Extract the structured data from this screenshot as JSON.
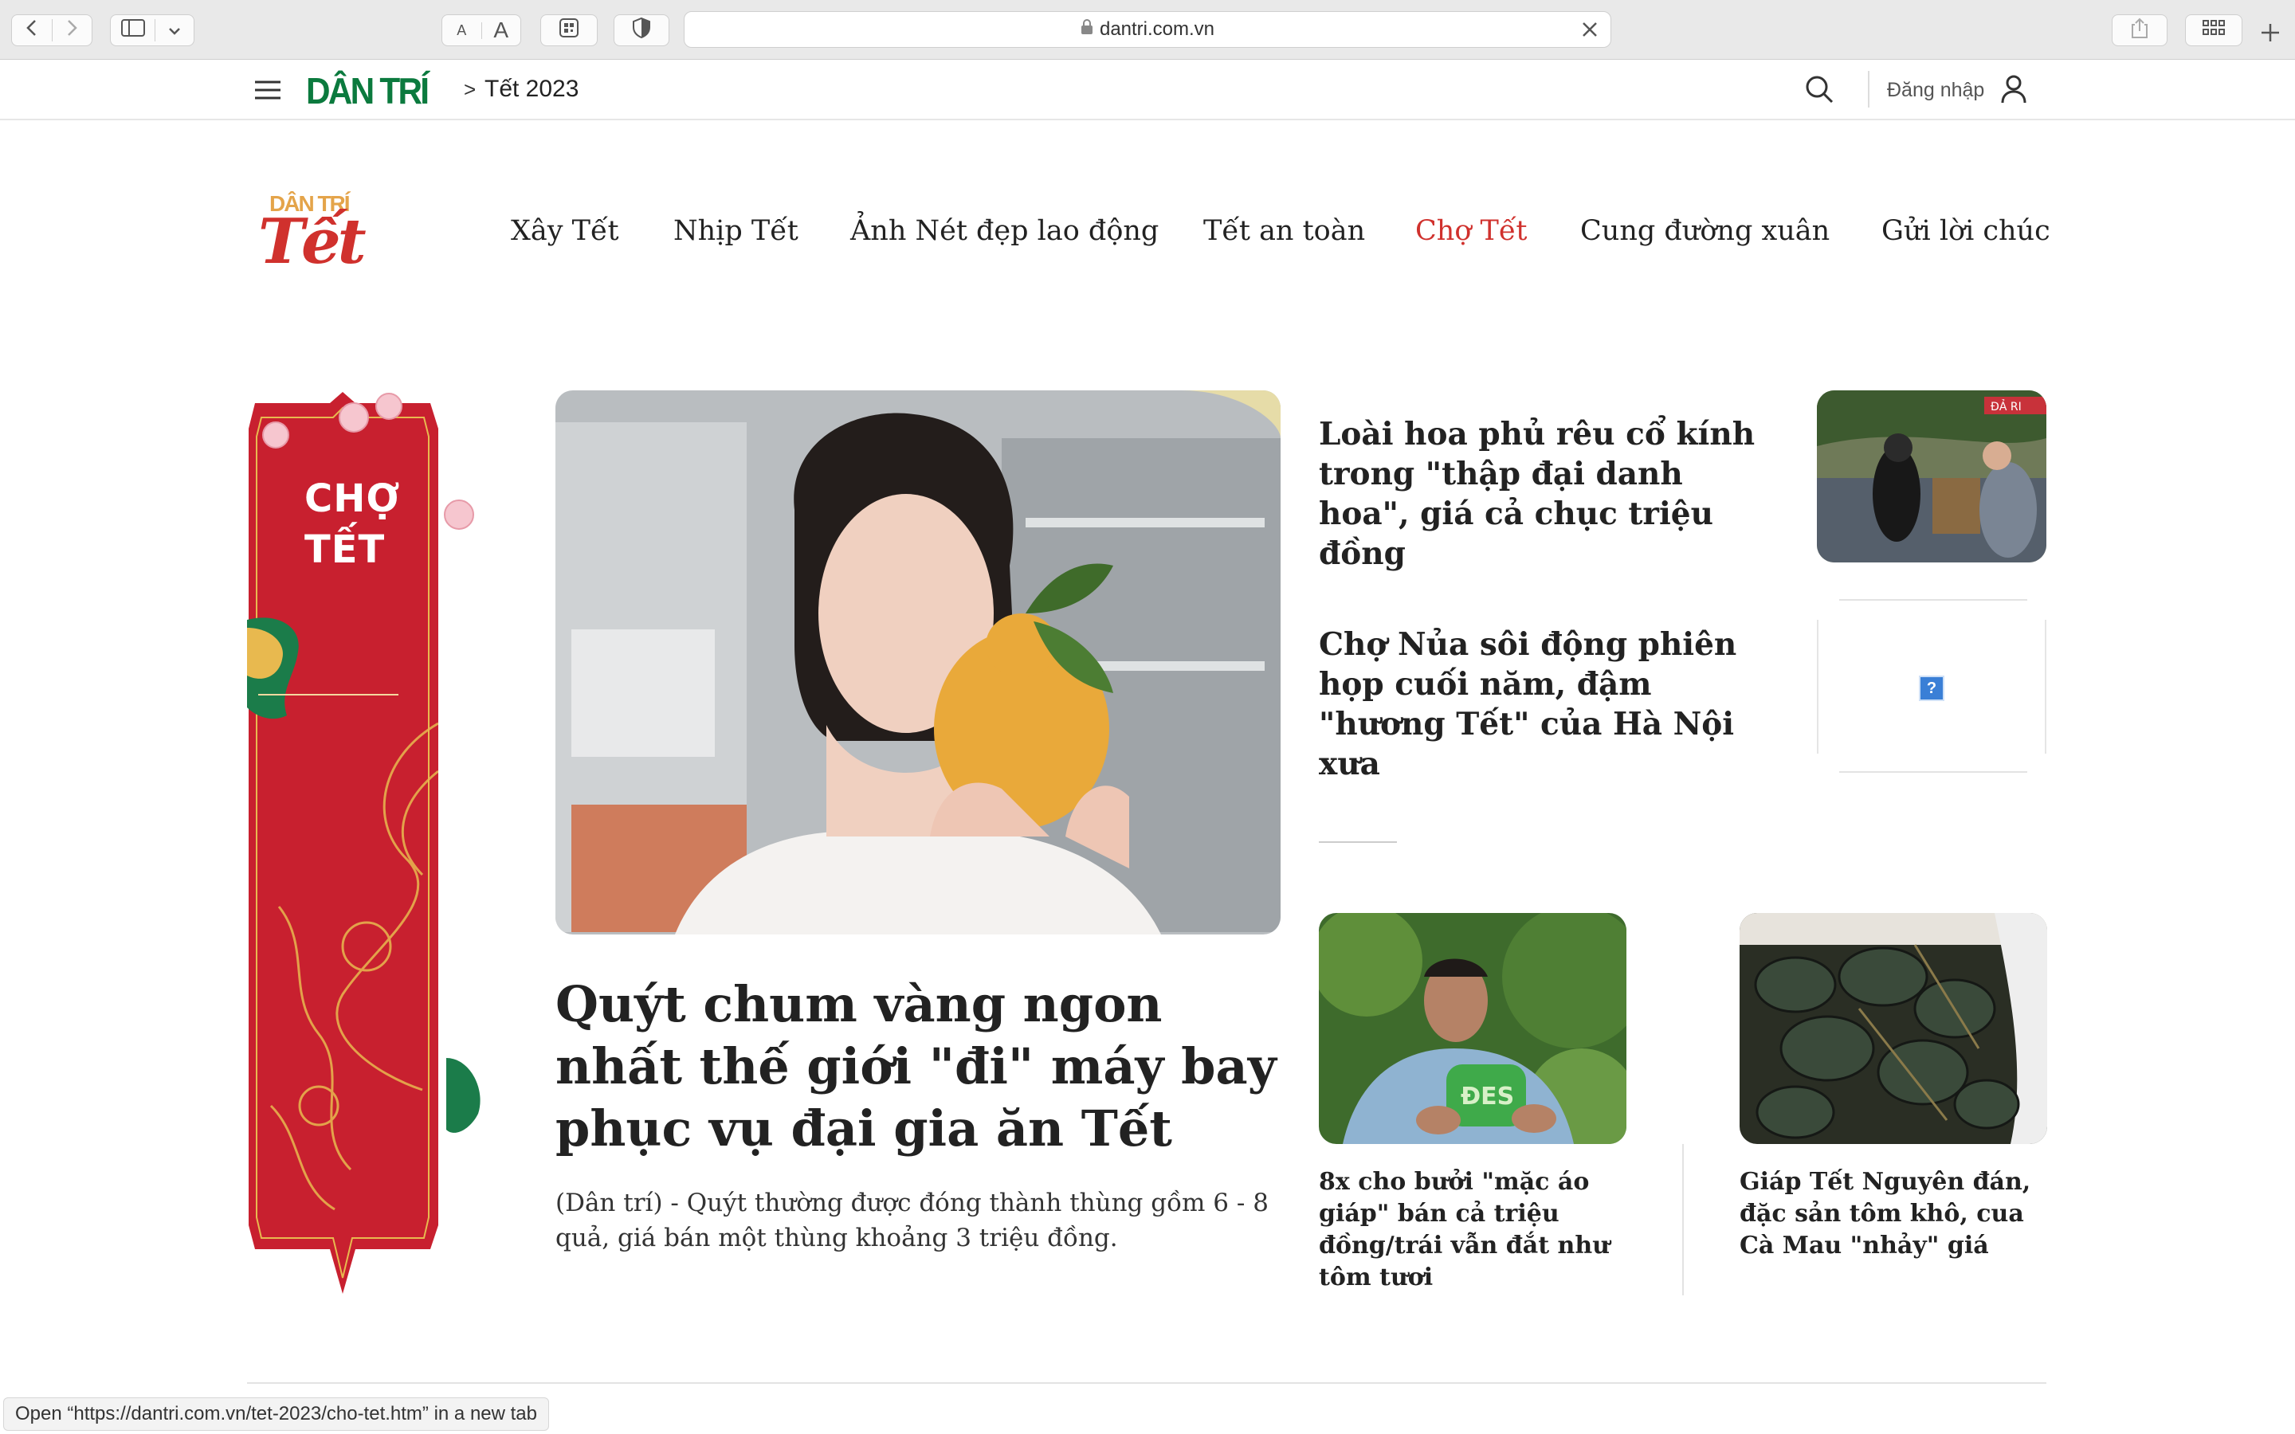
{
  "browser": {
    "url": "dantri.com.vn",
    "text_small_label": "A",
    "text_large_label": "A"
  },
  "site": {
    "logo_text": "DÂN TRÍ",
    "breadcrumb_sep": ">",
    "breadcrumb": "Tết 2023",
    "login_label": "Đăng nhập"
  },
  "tet_logo": {
    "top": "DÂN TRÍ",
    "main": "Tết"
  },
  "nav": {
    "items": [
      {
        "label": "Xây Tết"
      },
      {
        "label": "Nhịp Tết"
      },
      {
        "label": "Ảnh Nét đẹp lao động"
      },
      {
        "label": "Tết an toàn"
      },
      {
        "label": "Chợ Tết"
      },
      {
        "label": "Cung đường xuân"
      },
      {
        "label": "Gửi lời chúc"
      }
    ],
    "active_color": "#d0312d"
  },
  "banner": {
    "line1": "CHỢ",
    "line2": "TẾT"
  },
  "main_story": {
    "title": "Quýt chum vàng ngon nhất thế giới \"đi\" máy bay phục vụ đại gia ăn Tết",
    "sapo": "(Dân trí) - Quýt thường được đóng thành thùng gồm 6 - 8 quả, giá bán một thùng khoảng 3 triệu đồng."
  },
  "side_stories": [
    {
      "title": "Loài hoa phủ rêu cổ kính trong \"thập đại danh hoa\", giá cả chục triệu đồng"
    },
    {
      "title": "Chợ Nủa sôi động phiên họp cuối năm, đậm \"hương Tết\" của Hà Nội xưa"
    }
  ],
  "bottom_stories": [
    {
      "title": "8x cho bưởi \"mặc áo giáp\" bán cả triệu đồng/trái vẫn đắt như tôm tươi"
    },
    {
      "title": "Giáp Tết Nguyên đán, đặc sản tôm khô, cua Cà Mau \"nhảy\" giá"
    }
  ],
  "thumb_text": {
    "bag": "ĐES",
    "sign": "ĐẢ RI"
  },
  "broken_image_glyph": "?",
  "status_bar": "Open “https://dantri.com.vn/tet-2023/cho-tet.htm” in a new tab",
  "colors": {
    "brand_green": "#0b7a3e",
    "tet_red": "#d0312d",
    "banner_red": "#c8202f"
  }
}
